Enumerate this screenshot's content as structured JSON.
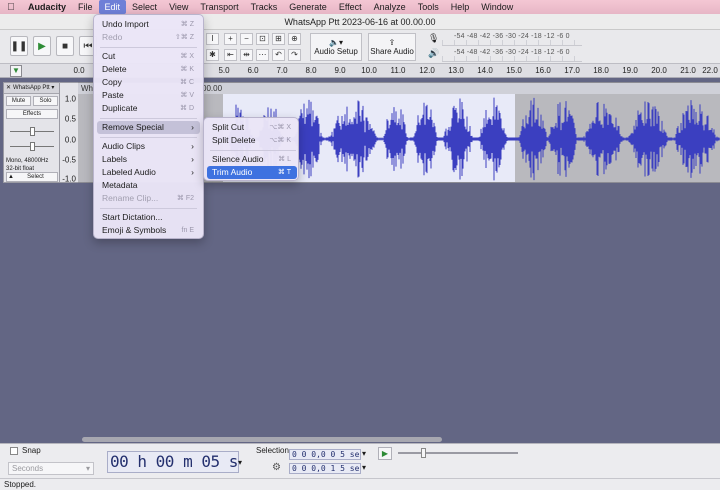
{
  "menubar": {
    "items": [
      "Audacity",
      "File",
      "Edit",
      "Select",
      "View",
      "Transport",
      "Tracks",
      "Generate",
      "Effect",
      "Analyze",
      "Tools",
      "Help",
      "Window"
    ]
  },
  "window": {
    "title": "WhatsApp Ptt 2023-06-16 at 00.00.00"
  },
  "toolbar": {
    "audio_setup": "Audio Setup",
    "share_audio": "Share Audio",
    "meter_scale": "-54 -48 -42 -36 -30 -24 -18 -12 -6 0"
  },
  "ruler": {
    "ticks": [
      "0.0",
      "5.0",
      "6.0",
      "7.0",
      "8.0",
      "9.0",
      "10.0",
      "11.0",
      "12.0",
      "13.0",
      "14.0",
      "15.0",
      "16.0",
      "17.0",
      "18.0",
      "19.0",
      "20.0",
      "21.0",
      "22.0"
    ]
  },
  "track": {
    "name": "WhatsApp Ptt",
    "mute": "Mute",
    "solo": "Solo",
    "effects": "Effects",
    "info_rate": "Mono, 48000Hz",
    "info_format": "32-bit float",
    "select": "Select",
    "clip_name": "Wh",
    "clip_name_tail": "00.00",
    "scale": [
      "1.0",
      "0.5",
      "0.0",
      "-0.5",
      "-1.0"
    ]
  },
  "edit_menu": {
    "items": [
      {
        "label": "Undo Import",
        "shortcut": "⌘ Z"
      },
      {
        "label": "Redo",
        "shortcut": "⇧⌘ Z"
      },
      {
        "label": "Cut",
        "shortcut": "⌘ X"
      },
      {
        "label": "Delete",
        "shortcut": "⌘ K"
      },
      {
        "label": "Copy",
        "shortcut": "⌘ C"
      },
      {
        "label": "Paste",
        "shortcut": "⌘ V"
      },
      {
        "label": "Duplicate",
        "shortcut": "⌘ D"
      },
      {
        "label": "Remove Special",
        "shortcut": "›"
      },
      {
        "label": "Audio Clips",
        "shortcut": "›"
      },
      {
        "label": "Labels",
        "shortcut": "›"
      },
      {
        "label": "Labeled Audio",
        "shortcut": "›"
      },
      {
        "label": "Metadata",
        "shortcut": ""
      },
      {
        "label": "Rename Clip...",
        "shortcut": "⌘ F2"
      },
      {
        "label": "Start Dictation...",
        "shortcut": ""
      },
      {
        "label": "Emoji & Symbols",
        "shortcut": "fn E"
      }
    ]
  },
  "remove_special_menu": {
    "items": [
      {
        "label": "Split Cut",
        "shortcut": "⌥⌘ X"
      },
      {
        "label": "Split Delete",
        "shortcut": "⌥⌘ K"
      },
      {
        "label": "Silence Audio",
        "shortcut": "⌘ L"
      },
      {
        "label": "Trim Audio",
        "shortcut": "⌘ T"
      }
    ]
  },
  "bottom": {
    "snap": "Snap",
    "seconds": "Seconds",
    "time": "00 h 00 m 05 s",
    "selection_label": "Selection",
    "sel_start": "0 0 0,0 0 5  seconds",
    "sel_end": "0 0 0,0 1 5  seconds"
  },
  "status": "Stopped.",
  "colors": {
    "waveform": "#3b3fc0",
    "selection": "#e8eaf8",
    "menu_highlight": "#3e72e0"
  }
}
